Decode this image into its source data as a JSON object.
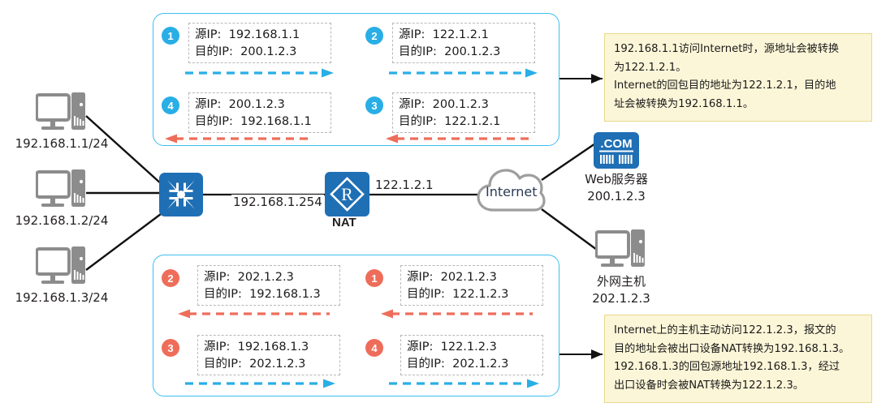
{
  "diagram": {
    "title": "NAT address translation diagram",
    "colors": {
      "blue_badge": "#29AEE6",
      "red_badge": "#EE6D5A",
      "box_border": "#3EBDF0",
      "callout_bg": "#FCF6D8",
      "callout_border": "#E8D98B",
      "device_blue": "#1F6FB5",
      "device_gray": "#8C8C8C",
      "flow_blue": "#29AEE6",
      "flow_red": "#EE6D5A"
    }
  },
  "hosts": [
    {
      "icon": "pc-icon",
      "label": "192.168.1.1/24"
    },
    {
      "icon": "pc-icon",
      "label": "192.168.1.2/24"
    },
    {
      "icon": "pc-icon",
      "label": "192.168.1.3/24"
    }
  ],
  "switch": {
    "icon": "switch-icon",
    "label": ""
  },
  "nat_router": {
    "icon": "router-icon",
    "glyph": "R",
    "name": "NAT",
    "inside_interface": "192.168.1.254",
    "outside_interface": "122.1.2.1"
  },
  "internet": {
    "icon": "cloud-icon",
    "label": "Internet"
  },
  "web_server": {
    "icon": "server-icon",
    "glyph": ".COM",
    "name": "Web服务器",
    "address": "200.1.2.3"
  },
  "external_host": {
    "icon": "pc-icon",
    "name": "外网主机",
    "address": "202.1.2.3"
  },
  "top_flow": {
    "packets": [
      {
        "step": "1",
        "badge_color": "blue",
        "src_label": "源IP:",
        "src_value": "192.168.1.1",
        "dst_label": "目的IP:",
        "dst_value": "200.1.2.3",
        "direction": "right",
        "arrow_color": "blue"
      },
      {
        "step": "2",
        "badge_color": "blue",
        "src_label": "源IP:",
        "src_value": "122.1.2.1",
        "dst_label": "目的IP:",
        "dst_value": "200.1.2.3",
        "direction": "right",
        "arrow_color": "blue"
      },
      {
        "step": "4",
        "badge_color": "blue",
        "src_label": "源IP:",
        "src_value": "200.1.2.3",
        "dst_label": "目的IP:",
        "dst_value": "192.168.1.1",
        "direction": "left",
        "arrow_color": "red"
      },
      {
        "step": "3",
        "badge_color": "blue",
        "src_label": "源IP:",
        "src_value": "200.1.2.3",
        "dst_label": "目的IP:",
        "dst_value": "122.1.2.1",
        "direction": "left",
        "arrow_color": "red"
      }
    ]
  },
  "bottom_flow": {
    "packets": [
      {
        "step": "2",
        "badge_color": "red",
        "src_label": "源IP:",
        "src_value": "202.1.2.3",
        "dst_label": "目的IP:",
        "dst_value": "192.168.1.3",
        "direction": "left",
        "arrow_color": "red"
      },
      {
        "step": "1",
        "badge_color": "red",
        "src_label": "源IP:",
        "src_value": "202.1.2.3",
        "dst_label": "目的IP:",
        "dst_value": "122.1.2.3",
        "direction": "left",
        "arrow_color": "red"
      },
      {
        "step": "3",
        "badge_color": "red",
        "src_label": "源IP:",
        "src_value": "192.168.1.3",
        "dst_label": "目的IP:",
        "dst_value": "202.1.2.3",
        "direction": "right",
        "arrow_color": "blue"
      },
      {
        "step": "4",
        "badge_color": "red",
        "src_label": "源IP:",
        "src_value": "122.1.2.3",
        "dst_label": "目的IP:",
        "dst_value": "202.1.2.3",
        "direction": "right",
        "arrow_color": "blue"
      }
    ]
  },
  "callout_top": {
    "lines": [
      "192.168.1.1访问Internet时，源地址会被转换",
      "为122.1.2.1。",
      "Internet的回包目的地址为122.1.2.1，目的地",
      "址会被转换为192.168.1.1。"
    ]
  },
  "callout_bottom": {
    "lines": [
      "Internet上的主机主动访问122.1.2.3，报文的",
      "目的地址会被出口设备NAT转换为192.168.1.3。",
      "192.168.1.3的回包源地址192.168.1.3，经过",
      "出口设备时会被NAT转换为122.1.2.3。"
    ]
  }
}
